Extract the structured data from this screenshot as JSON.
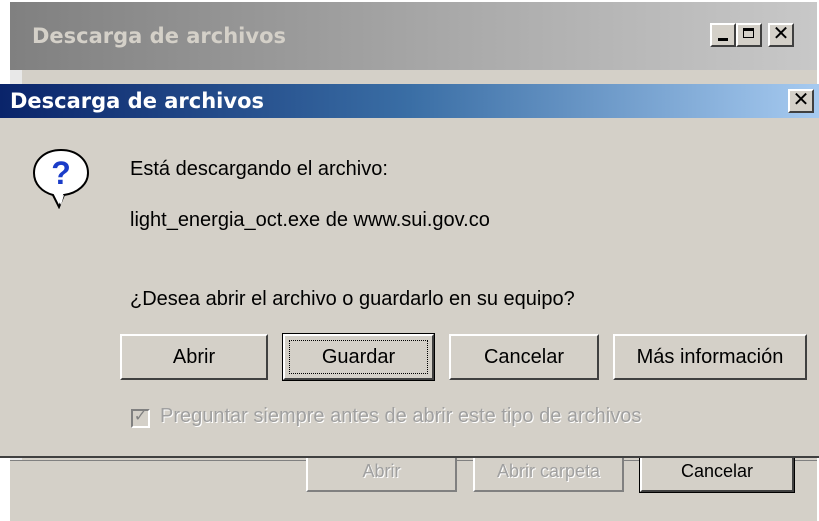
{
  "back_window": {
    "title": "Descarga de archivos",
    "buttons": {
      "open_label": "Abrir",
      "open_folder_label": "Abrir carpeta",
      "cancel_label": "Cancelar"
    },
    "title_buttons": {
      "minimize": "minimize-icon",
      "maximize": "maximize-icon",
      "close": "close-icon",
      "close_glyph": "✕"
    }
  },
  "dialog": {
    "title": "Descarga de archivos",
    "close_glyph": "✕",
    "icon": "question-icon",
    "message_downloading": "Está descargando el archivo:",
    "filename_line": "light_energia_oct.exe de www.sui.gov.co",
    "question": "¿Desea abrir el archivo o guardarlo en su equipo?",
    "buttons": {
      "open_label": "Abrir",
      "save_label": "Guardar",
      "cancel_label": "Cancelar",
      "more_info_label": "Más información"
    },
    "checkbox": {
      "label": "Preguntar siempre antes de abrir este tipo de archivos",
      "checked": true,
      "mark": "✓"
    }
  },
  "colors": {
    "active_title_start": "#0a246a",
    "active_title_end": "#a6caf0",
    "inactive_title": "#808080",
    "face": "#d4d0c8"
  }
}
